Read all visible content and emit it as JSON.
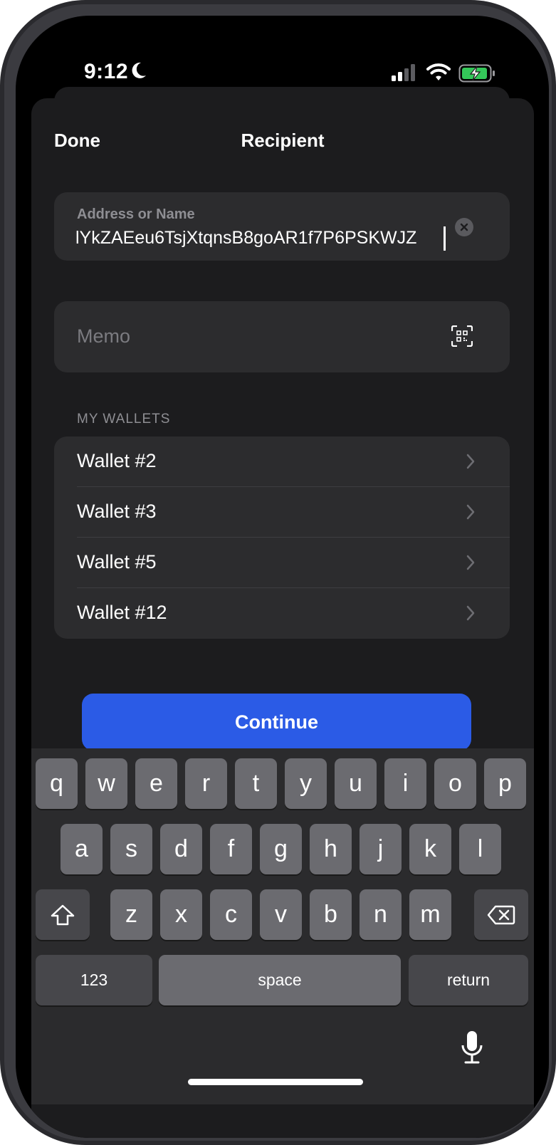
{
  "status_bar": {
    "time": "9:12"
  },
  "header": {
    "done_label": "Done",
    "title": "Recipient"
  },
  "address_field": {
    "label": "Address or Name",
    "value": "lYkZAEeu6TsjXtqnsB8goAR1f7P6PSKWJZ"
  },
  "memo_field": {
    "placeholder": "Memo"
  },
  "wallets": {
    "section_title": "MY WALLETS",
    "items": [
      {
        "label": "Wallet #2"
      },
      {
        "label": "Wallet #3"
      },
      {
        "label": "Wallet #5"
      },
      {
        "label": "Wallet #12"
      }
    ]
  },
  "continue_label": "Continue",
  "keyboard": {
    "row1": [
      "q",
      "w",
      "e",
      "r",
      "t",
      "y",
      "u",
      "i",
      "o",
      "p"
    ],
    "row2": [
      "a",
      "s",
      "d",
      "f",
      "g",
      "h",
      "j",
      "k",
      "l"
    ],
    "row3": [
      "z",
      "x",
      "c",
      "v",
      "b",
      "n",
      "m"
    ],
    "numbers_label": "123",
    "space_label": "space",
    "return_label": "return"
  },
  "colors": {
    "accent": "#2b5be6",
    "background": "#1c1c1e",
    "field": "#2c2c2e",
    "battery_green": "#34c759"
  }
}
